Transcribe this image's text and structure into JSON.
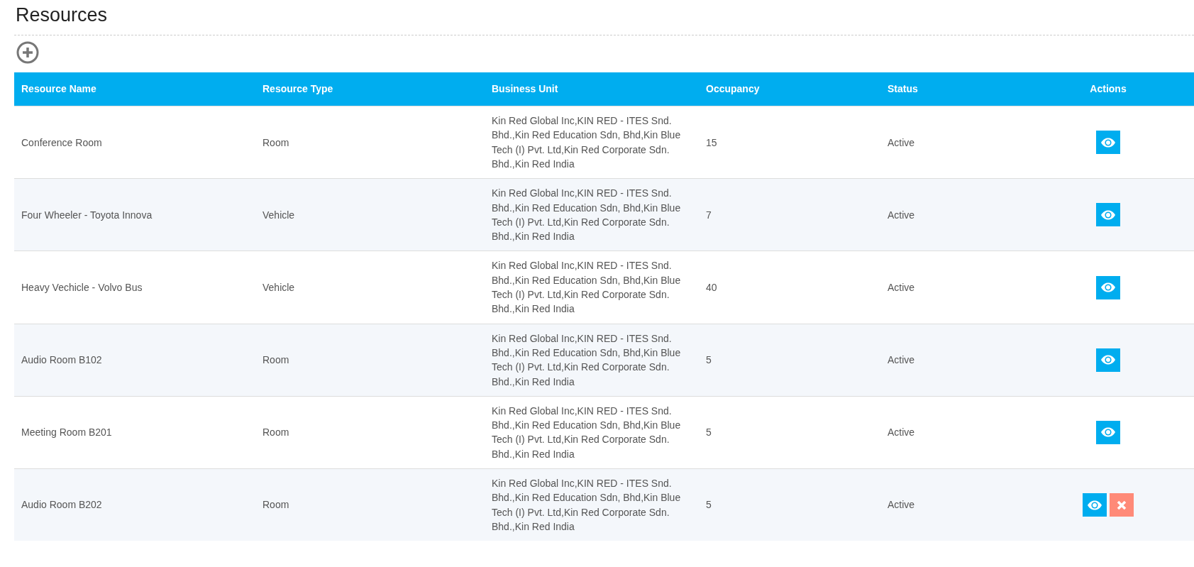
{
  "page": {
    "title": "Resources"
  },
  "table": {
    "columns": [
      "Resource Name",
      "Resource Type",
      "Business Unit",
      "Occupancy",
      "Status",
      "Actions"
    ],
    "rows": [
      {
        "name": "Conference Room",
        "type": "Room",
        "business_unit": "Kin Red Global Inc,KIN RED - ITES Snd. Bhd.,Kin Red Education Sdn, Bhd,Kin Blue Tech (I) Pvt. Ltd,Kin Red Corporate Sdn. Bhd.,Kin Red India",
        "occupancy": "15",
        "status": "Active",
        "actions": [
          {
            "kind": "view"
          }
        ]
      },
      {
        "name": "Four Wheeler - Toyota Innova",
        "type": "Vehicle",
        "business_unit": "Kin Red Global Inc,KIN RED - ITES Snd. Bhd.,Kin Red Education Sdn, Bhd,Kin Blue Tech (I) Pvt. Ltd,Kin Red Corporate Sdn. Bhd.,Kin Red India",
        "occupancy": "7",
        "status": "Active",
        "actions": [
          {
            "kind": "view"
          }
        ]
      },
      {
        "name": "Heavy Vechicle - Volvo Bus",
        "type": "Vehicle",
        "business_unit": "Kin Red Global Inc,KIN RED - ITES Snd. Bhd.,Kin Red Education Sdn, Bhd,Kin Blue Tech (I) Pvt. Ltd,Kin Red Corporate Sdn. Bhd.,Kin Red India",
        "occupancy": "40",
        "status": "Active",
        "actions": [
          {
            "kind": "view"
          }
        ]
      },
      {
        "name": "Audio Room B102",
        "type": "Room",
        "business_unit": "Kin Red Global Inc,KIN RED - ITES Snd. Bhd.,Kin Red Education Sdn, Bhd,Kin Blue Tech (I) Pvt. Ltd,Kin Red Corporate Sdn. Bhd.,Kin Red India",
        "occupancy": "5",
        "status": "Active",
        "actions": [
          {
            "kind": "view"
          }
        ]
      },
      {
        "name": "Meeting Room B201",
        "type": "Room",
        "business_unit": "Kin Red Global Inc,KIN RED - ITES Snd. Bhd.,Kin Red Education Sdn, Bhd,Kin Blue Tech (I) Pvt. Ltd,Kin Red Corporate Sdn. Bhd.,Kin Red India",
        "occupancy": "5",
        "status": "Active",
        "actions": [
          {
            "kind": "view"
          }
        ]
      },
      {
        "name": "Audio Room B202",
        "type": "Room",
        "business_unit": "Kin Red Global Inc,KIN RED - ITES Snd. Bhd.,Kin Red Education Sdn, Bhd,Kin Blue Tech (I) Pvt. Ltd,Kin Red Corporate Sdn. Bhd.,Kin Red India",
        "occupancy": "5",
        "status": "Active",
        "actions": [
          {
            "kind": "view"
          },
          {
            "kind": "delete"
          }
        ]
      }
    ]
  }
}
